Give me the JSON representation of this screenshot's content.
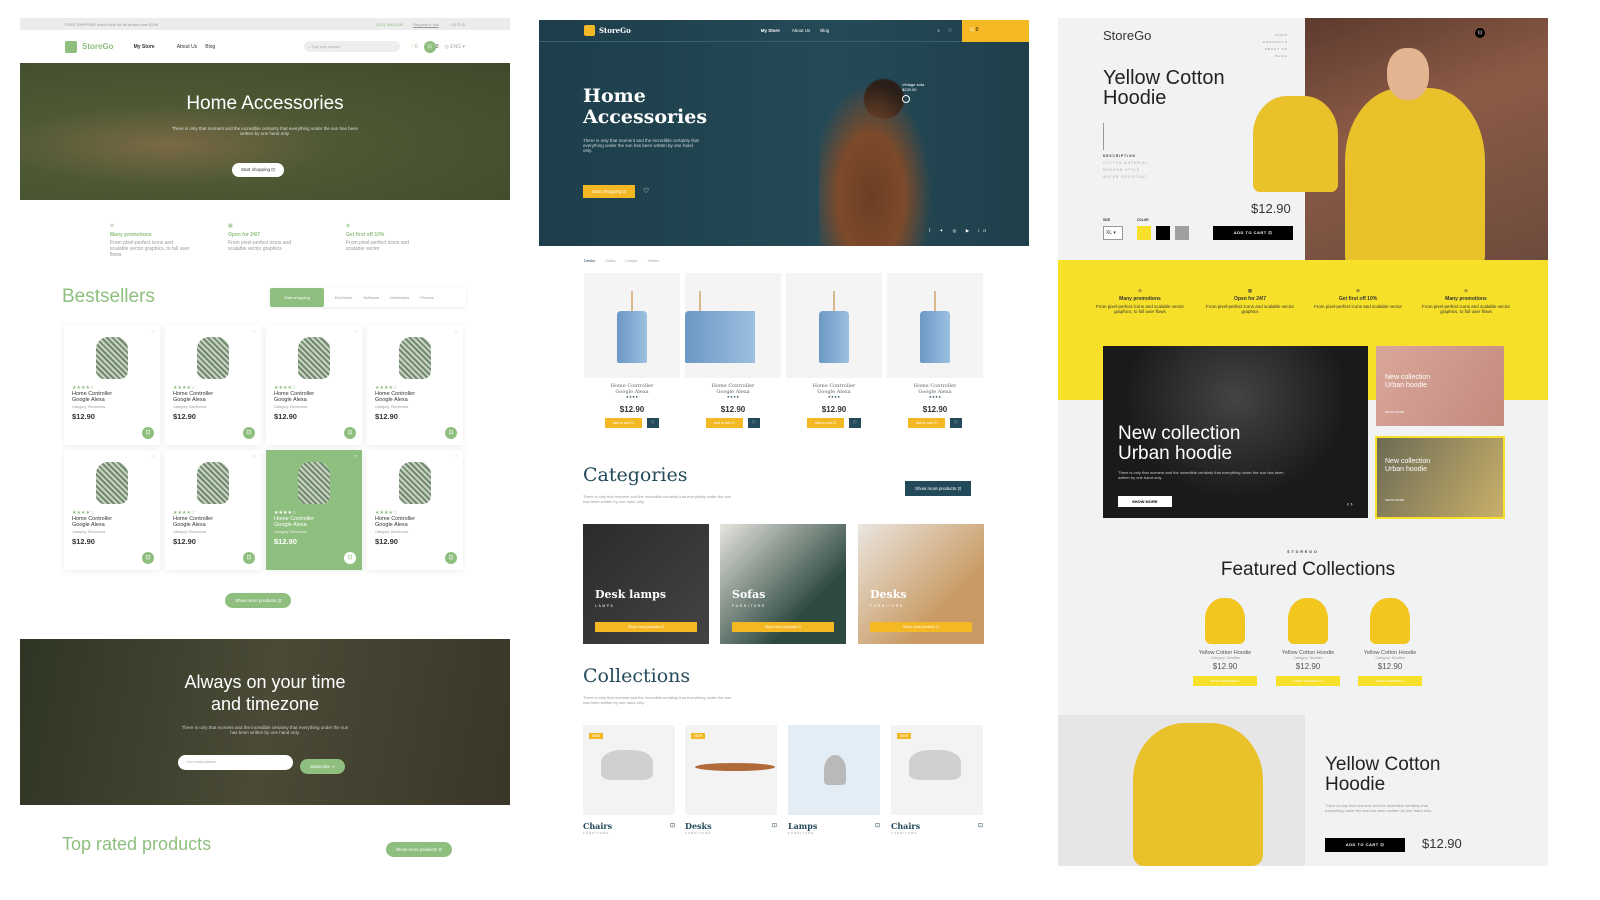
{
  "left": {
    "topbar": {
      "shipping": "FREE SHIPPING world wide for all orders over $199",
      "phone": "(312) 368-1230",
      "request": "Request a call"
    },
    "nav": {
      "logo": "StoreGo",
      "logo_sub": "LOCAL SHOP",
      "items": [
        "My Store",
        "About Us",
        "Blog"
      ],
      "search_placeholder": "Type your product...",
      "wishlist_count": "0",
      "cart_count": "0",
      "lang": "ENG"
    },
    "hero": {
      "title": "Home Accessories",
      "text": "There is only that moment and the incredible certainty that everything under the sun has been written by one hand only.",
      "button": "Start shopping"
    },
    "features": [
      {
        "title": "Many promotions",
        "text": "From pixel-perfect icons and scalable vector graphics, to full user flows"
      },
      {
        "title": "Open for 24/7",
        "text": "From pixel-perfect icons and scalable vector graphics"
      },
      {
        "title": "Get first off 10%",
        "text": "From pixel-perfect icons and scalable vector"
      }
    ],
    "bestsellers": {
      "title": "Bestsellers",
      "tabs": [
        "Start shopping",
        "Electronic",
        "Software",
        "Notebooks",
        "Phones"
      ],
      "product": {
        "name1": "Home Controller",
        "name2": "Google Alexa",
        "category_label": "Category:",
        "category": "Electronics",
        "price": "$12.90",
        "rating": 4
      },
      "show_more": "Show more products"
    },
    "banner": {
      "title1": "Always on your time",
      "title2": "and timezone",
      "text": "There is only that moment and the incredible certainty that everything under the sun has been written by one hand only.",
      "email_placeholder": "Your email address",
      "subscribe": "Subscribe"
    },
    "top_rated": {
      "title": "Top rated products",
      "button": "Show more products"
    }
  },
  "middle": {
    "nav": {
      "logo": "StoreGo",
      "logo_sub": "LOCAL SHOP",
      "items": [
        "My Store",
        "About Us",
        "Blog"
      ],
      "cart_count": "0"
    },
    "hero": {
      "title1": "Home",
      "title2": "Accessories",
      "text": "There is only that moment and the incredible certainty that everything under the sun has been written by one hand only.",
      "button": "Start shopping",
      "tag_name": "Vintage sofa",
      "tag_price": "$220.00"
    },
    "tabs": [
      "Desks",
      "Sofas",
      "Lamps",
      "Tables"
    ],
    "product": {
      "name1": "Home Controller",
      "name2": "Google Alexa",
      "price": "$12.90",
      "add": "Add to cart"
    },
    "categories": {
      "title": "Categories",
      "text": "There is only that moment and the incredible certainty that everything under the sun has been written by one hand only.",
      "button": "Show more products",
      "items": [
        {
          "title": "Desk lamps",
          "sub": "LAMPS"
        },
        {
          "title": "Sofas",
          "sub": "FURNITURE"
        },
        {
          "title": "Desks",
          "sub": "FURNITURE"
        }
      ]
    },
    "collections": {
      "title": "Collections",
      "text": "There is only that moment and the incredible certainty that everything under the sun has been written by one hand only.",
      "badge": "NEW",
      "items": [
        {
          "title": "Chairs",
          "sub": "FURNITURE",
          "new": true
        },
        {
          "title": "Desks",
          "sub": "FURNITURE",
          "new": true
        },
        {
          "title": "Lamps",
          "sub": "FURNITURE",
          "new": false
        },
        {
          "title": "Chairs",
          "sub": "FURNITURE",
          "new": true
        }
      ]
    }
  },
  "right": {
    "logo": "StoreGo",
    "menu": [
      "SHOP",
      "PRODUCTS",
      "ABOUT US",
      "BLOG"
    ],
    "product": {
      "title1": "Yellow Cotton",
      "title2": "Hoodie",
      "desc_label": "DESCRIPTION",
      "desc": [
        "COTTON MATERIAL",
        "MODERN STYLE",
        "WATER RESISTANT"
      ],
      "size_label": "SIZE",
      "size": "XL",
      "color_label": "COLOR",
      "colors": [
        "#f7e02a",
        "#000000",
        "#a0a0a0"
      ],
      "price": "$12.90",
      "add": "ADD TO CART"
    },
    "features": [
      {
        "title": "Many promotions",
        "text": "From pixel-perfect icons and scalable vector graphics, to full user flows"
      },
      {
        "title": "Open for 24/7",
        "text": "From pixel-perfect icons and scalable vector graphics"
      },
      {
        "title": "Get first off 10%",
        "text": "From pixel-perfect icons and scalable vector"
      },
      {
        "title": "Many promotions",
        "text": "From pixel-perfect icons and scalable vector graphics, to full user flows"
      }
    ],
    "collection": {
      "title1": "New collection",
      "title2": "Urban hoodie",
      "text": "There is only that moment and the incredible certainty that everything under the sun has been written by one hand only.",
      "button": "SHOW MORE",
      "small_title1": "New collection",
      "small_title2": "Urban hoodie",
      "small_button": "SHOW MORE"
    },
    "featured": {
      "kicker": "STOREGO",
      "title": "Featured Collections",
      "item": {
        "name": "Yellow Cotton Hoodie",
        "category": "Category: Hoodies",
        "price": "$12.90",
        "button": "START SHOPPING"
      }
    },
    "bottom": {
      "title1": "Yellow Cotton",
      "title2": "Hoodie",
      "text": "There is only that moment and the incredible certainty that everything under the sun has been written by one hand only.",
      "add": "ADD TO CART",
      "price": "$12.90"
    }
  },
  "colors": {
    "green": "#8fbf7f",
    "teal": "#234a5a",
    "amber": "#f4b824",
    "yellow": "#f7e02a"
  }
}
